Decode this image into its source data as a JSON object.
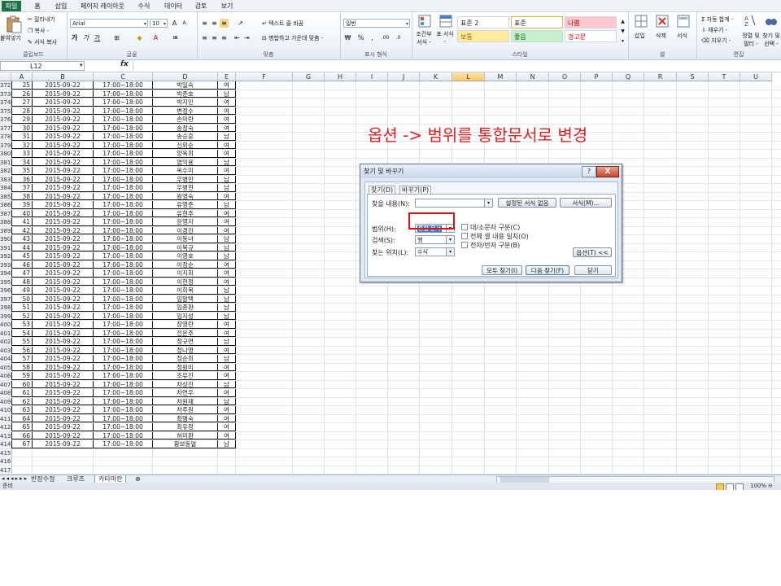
{
  "tabs": [
    "파일",
    "홈",
    "삽입",
    "페이지 레이아웃",
    "수식",
    "데이터",
    "검토",
    "보기"
  ],
  "ribbon": {
    "paste": "붙여넣기",
    "cut": "잘라내기",
    "copy": "복사 -",
    "format_painter": "서식 복사",
    "clipboard": "클립보드",
    "font_name": "Arial",
    "font_size": "10",
    "font_group": "글꼴",
    "wrap_text": "텍스트 줄 바꿈",
    "merge_center": "병합하고 가운데 맞춤 -",
    "align_group": "맞춤",
    "number_format": "일반",
    "number_group": "표시 형식",
    "cond_format": "조건부 서식 -",
    "format_table": "표 서식 -",
    "styles": [
      "표준 2",
      "표준",
      "나쁨",
      "보통",
      "좋음",
      "경고문"
    ],
    "styles_group": "스타일",
    "insert": "삽입",
    "delete": "삭제",
    "format": "서식",
    "cells_group": "셀",
    "autosum": "자동 합계 -",
    "fill": "채우기 -",
    "clear": "지우기 -",
    "sort_filter": "정렬 및 필터 -",
    "find_select": "찾기 및 선택 -",
    "edit_group": "편집"
  },
  "formula_bar": {
    "name_box": "L12",
    "fx": "fx"
  },
  "columns": [
    "A",
    "B",
    "C",
    "D",
    "E",
    "F",
    "G",
    "H",
    "I",
    "J",
    "K",
    "L",
    "M",
    "N",
    "O",
    "P",
    "Q",
    "R",
    "S",
    "T",
    "U"
  ],
  "selected_column": "L",
  "rows": [
    [
      "372",
      "25",
      "2015-09-22",
      "17:00~18:00",
      "박일숙",
      "여"
    ],
    [
      "373",
      "26",
      "2015-09-22",
      "17:00~18:00",
      "박준호",
      "남"
    ],
    [
      "374",
      "27",
      "2015-09-22",
      "17:00~18:00",
      "박지민",
      "여"
    ],
    [
      "375",
      "28",
      "2015-09-22",
      "17:00~18:00",
      "변정수",
      "여"
    ],
    [
      "376",
      "29",
      "2015-09-22",
      "17:00~18:00",
      "손미란",
      "여"
    ],
    [
      "377",
      "30",
      "2015-09-22",
      "17:00~18:00",
      "송정숙",
      "여"
    ],
    [
      "378",
      "31",
      "2015-09-22",
      "17:00~18:00",
      "송승훈",
      "남"
    ],
    [
      "379",
      "32",
      "2015-09-22",
      "17:00~18:00",
      "신외순",
      "여"
    ],
    [
      "380",
      "33",
      "2015-09-22",
      "17:00~18:00",
      "양옥희",
      "여"
    ],
    [
      "381",
      "34",
      "2015-09-22",
      "17:00~18:00",
      "염익용",
      "남"
    ],
    [
      "382",
      "35",
      "2015-09-22",
      "17:00~18:00",
      "옥수미",
      "여"
    ],
    [
      "383",
      "36",
      "2015-09-22",
      "17:00~18:00",
      "우병민",
      "남"
    ],
    [
      "384",
      "37",
      "2015-09-22",
      "17:00~18:00",
      "우병현",
      "남"
    ],
    [
      "385",
      "38",
      "2015-09-22",
      "17:00~18:00",
      "원영숙",
      "여"
    ],
    [
      "386",
      "39",
      "2015-09-22",
      "17:00~18:00",
      "유영준",
      "남"
    ],
    [
      "387",
      "40",
      "2015-09-22",
      "17:00~18:00",
      "유현주",
      "여"
    ],
    [
      "388",
      "41",
      "2015-09-22",
      "17:00~18:00",
      "윤영자",
      "여"
    ],
    [
      "389",
      "42",
      "2015-09-22",
      "17:00~18:00",
      "이경진",
      "여"
    ],
    [
      "390",
      "43",
      "2015-09-22",
      "17:00~18:00",
      "이동녀",
      "남"
    ],
    [
      "391",
      "44",
      "2015-09-22",
      "17:00~18:00",
      "이복규",
      "남"
    ],
    [
      "392",
      "45",
      "2015-09-22",
      "17:00~18:00",
      "이영호",
      "남"
    ],
    [
      "393",
      "46",
      "2015-09-22",
      "17:00~18:00",
      "이정순",
      "여"
    ],
    [
      "394",
      "47",
      "2015-09-22",
      "17:00~18:00",
      "이지희",
      "여"
    ],
    [
      "395",
      "48",
      "2015-09-22",
      "17:00~18:00",
      "이현정",
      "여"
    ],
    [
      "396",
      "49",
      "2015-09-22",
      "17:00~18:00",
      "이희목",
      "남"
    ],
    [
      "397",
      "50",
      "2015-09-22",
      "17:00~18:00",
      "임말택",
      "남"
    ],
    [
      "398",
      "51",
      "2015-09-22",
      "17:00~18:00",
      "임종환",
      "남"
    ],
    [
      "399",
      "52",
      "2015-09-22",
      "17:00~18:00",
      "임지성",
      "남"
    ],
    [
      "400",
      "53",
      "2015-09-22",
      "17:00~18:00",
      "장영란",
      "여"
    ],
    [
      "401",
      "54",
      "2015-09-22",
      "17:00~18:00",
      "전은주",
      "여"
    ],
    [
      "402",
      "55",
      "2015-09-22",
      "17:00~18:00",
      "정규연",
      "남"
    ],
    [
      "403",
      "56",
      "2015-09-22",
      "17:00~18:00",
      "정나영",
      "여"
    ],
    [
      "404",
      "57",
      "2015-09-22",
      "17:00~18:00",
      "정순희",
      "남"
    ],
    [
      "405",
      "58",
      "2015-09-22",
      "17:00~18:00",
      "정원미",
      "여"
    ],
    [
      "406",
      "59",
      "2015-09-22",
      "17:00~18:00",
      "조유진",
      "여"
    ],
    [
      "407",
      "60",
      "2015-09-22",
      "17:00~18:00",
      "차상진",
      "남"
    ],
    [
      "408",
      "61",
      "2015-09-22",
      "17:00~18:00",
      "차연우",
      "여"
    ],
    [
      "409",
      "62",
      "2015-09-22",
      "17:00~18:00",
      "차원재",
      "남"
    ],
    [
      "410",
      "63",
      "2015-09-22",
      "17:00~18:00",
      "차주원",
      "여"
    ],
    [
      "411",
      "64",
      "2015-09-22",
      "17:00~18:00",
      "최명숙",
      "여"
    ],
    [
      "412",
      "65",
      "2015-09-22",
      "17:00~18:00",
      "최유정",
      "여"
    ],
    [
      "413",
      "66",
      "2015-09-22",
      "17:00~18:00",
      "허미환",
      "여"
    ],
    [
      "414",
      "67",
      "2015-09-22",
      "17:00~18:00",
      "황보동열",
      "남"
    ],
    [
      "415",
      "",
      "",
      "",
      "",
      ""
    ],
    [
      "416",
      "",
      "",
      "",
      "",
      ""
    ],
    [
      "417",
      "",
      "",
      "",
      "",
      ""
    ]
  ],
  "sheet_tabs": [
    "반장수정",
    "크루즈",
    "카타마란"
  ],
  "active_sheet": "카타마란",
  "status": {
    "ready": "준비",
    "zoom": "100%"
  },
  "annotation": "옵션 -> 범위를 통합문서로 변경",
  "dialog": {
    "title": "찾기 및 바꾸기",
    "tab_find": "찾기(D)",
    "tab_replace": "바꾸기(P)",
    "find_what_label": "찾을 내용(N):",
    "find_what_value": "",
    "no_format": "설정된 서식 없음",
    "format_btn": "서식(M)...",
    "within_label": "범위(H):",
    "within_value": "통합 문서",
    "search_label": "검색(S):",
    "search_value": "행",
    "look_in_label": "찾는 위치(L):",
    "look_in_value": "수식",
    "match_case": "대/소문자 구분(C)",
    "match_entire": "전체 셀 내용 일치(O)",
    "match_byte": "전자/반자 구분(B)",
    "options_btn": "옵션(T) <<",
    "find_all": "모두 찾기(I)",
    "find_next": "다음 찾기(F)",
    "close": "닫기",
    "help": "?",
    "close_x": "X"
  }
}
